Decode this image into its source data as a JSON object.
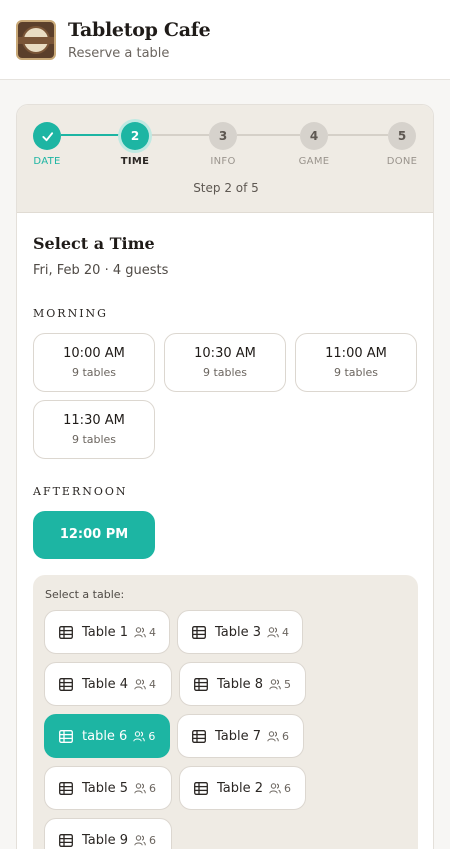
{
  "header": {
    "title": "Tabletop Cafe",
    "subtitle": "Reserve a table",
    "logo_icon": "cafe-logo-icon"
  },
  "stepper": {
    "steps": [
      {
        "label": "DATE",
        "number": "",
        "state": "done"
      },
      {
        "label": "TIME",
        "number": "2",
        "state": "active"
      },
      {
        "label": "INFO",
        "number": "3",
        "state": "pending"
      },
      {
        "label": "GAME",
        "number": "4",
        "state": "pending"
      },
      {
        "label": "DONE",
        "number": "5",
        "state": "pending"
      }
    ],
    "caption": "Step 2 of 5"
  },
  "main": {
    "title": "Select a Time",
    "subtitle": "Fri, Feb 20 · 4 guests",
    "morning_label": "MORNING",
    "morning_slots": [
      {
        "time": "10:00 AM",
        "tables": "9 tables"
      },
      {
        "time": "10:30 AM",
        "tables": "9 tables"
      },
      {
        "time": "11:00 AM",
        "tables": "9 tables"
      },
      {
        "time": "11:30 AM",
        "tables": "9 tables"
      }
    ],
    "afternoon_label": "AFTERNOON",
    "afternoon_slots": [
      {
        "time": "12:00 PM",
        "selected": true
      }
    ]
  },
  "table_select": {
    "label": "Select a table:",
    "tables": [
      {
        "name": "Table 1",
        "capacity": "4"
      },
      {
        "name": "Table 3",
        "capacity": "4"
      },
      {
        "name": "Table 4",
        "capacity": "4"
      },
      {
        "name": "Table 8",
        "capacity": "5"
      },
      {
        "name": "table 6",
        "capacity": "6",
        "selected": true
      },
      {
        "name": "Table 7",
        "capacity": "6"
      },
      {
        "name": "Table 5",
        "capacity": "6"
      },
      {
        "name": "Table 2",
        "capacity": "6"
      },
      {
        "name": "Table 9",
        "capacity": "6"
      }
    ]
  },
  "colors": {
    "accent": "#1db5a3",
    "panel": "#efebe4",
    "text": "#2b2724"
  },
  "icons": {
    "table": "table-grid-icon",
    "capacity": "people-icon",
    "done_step": "check-icon"
  }
}
